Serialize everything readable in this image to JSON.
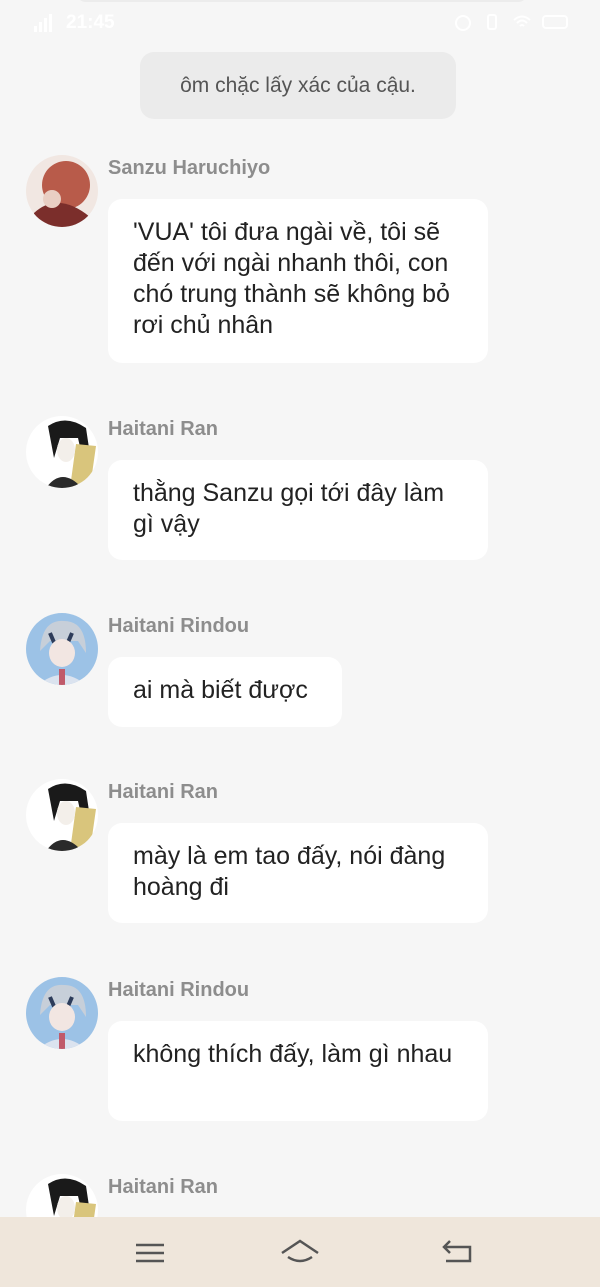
{
  "status_bar": {
    "time": "21:45"
  },
  "system_message": "ôm chặc lấy xác của cậu.",
  "messages": [
    {
      "sender": "Sanzu Haruchiyo",
      "text": "'VUA' tôi đưa ngài về, tôi sẽ đến với ngài nhanh thôi, con chó trung thành sẽ không bỏ rơi chủ nhân"
    },
    {
      "sender": "Haitani Ran",
      "text": "thằng Sanzu gọi tới đây làm gì vậy"
    },
    {
      "sender": "Haitani Rindou",
      "text": "ai mà biết được"
    },
    {
      "sender": "Haitani Ran",
      "text": "mày là em tao đấy, nói đàng hoàng đi"
    },
    {
      "sender": "Haitani Rindou",
      "text": "không thích đấy, làm gì nhau"
    },
    {
      "sender": "Haitani Ran",
      "text": ""
    }
  ],
  "nav": {
    "icons": [
      "menu-icon",
      "home-icon",
      "back-icon"
    ]
  }
}
